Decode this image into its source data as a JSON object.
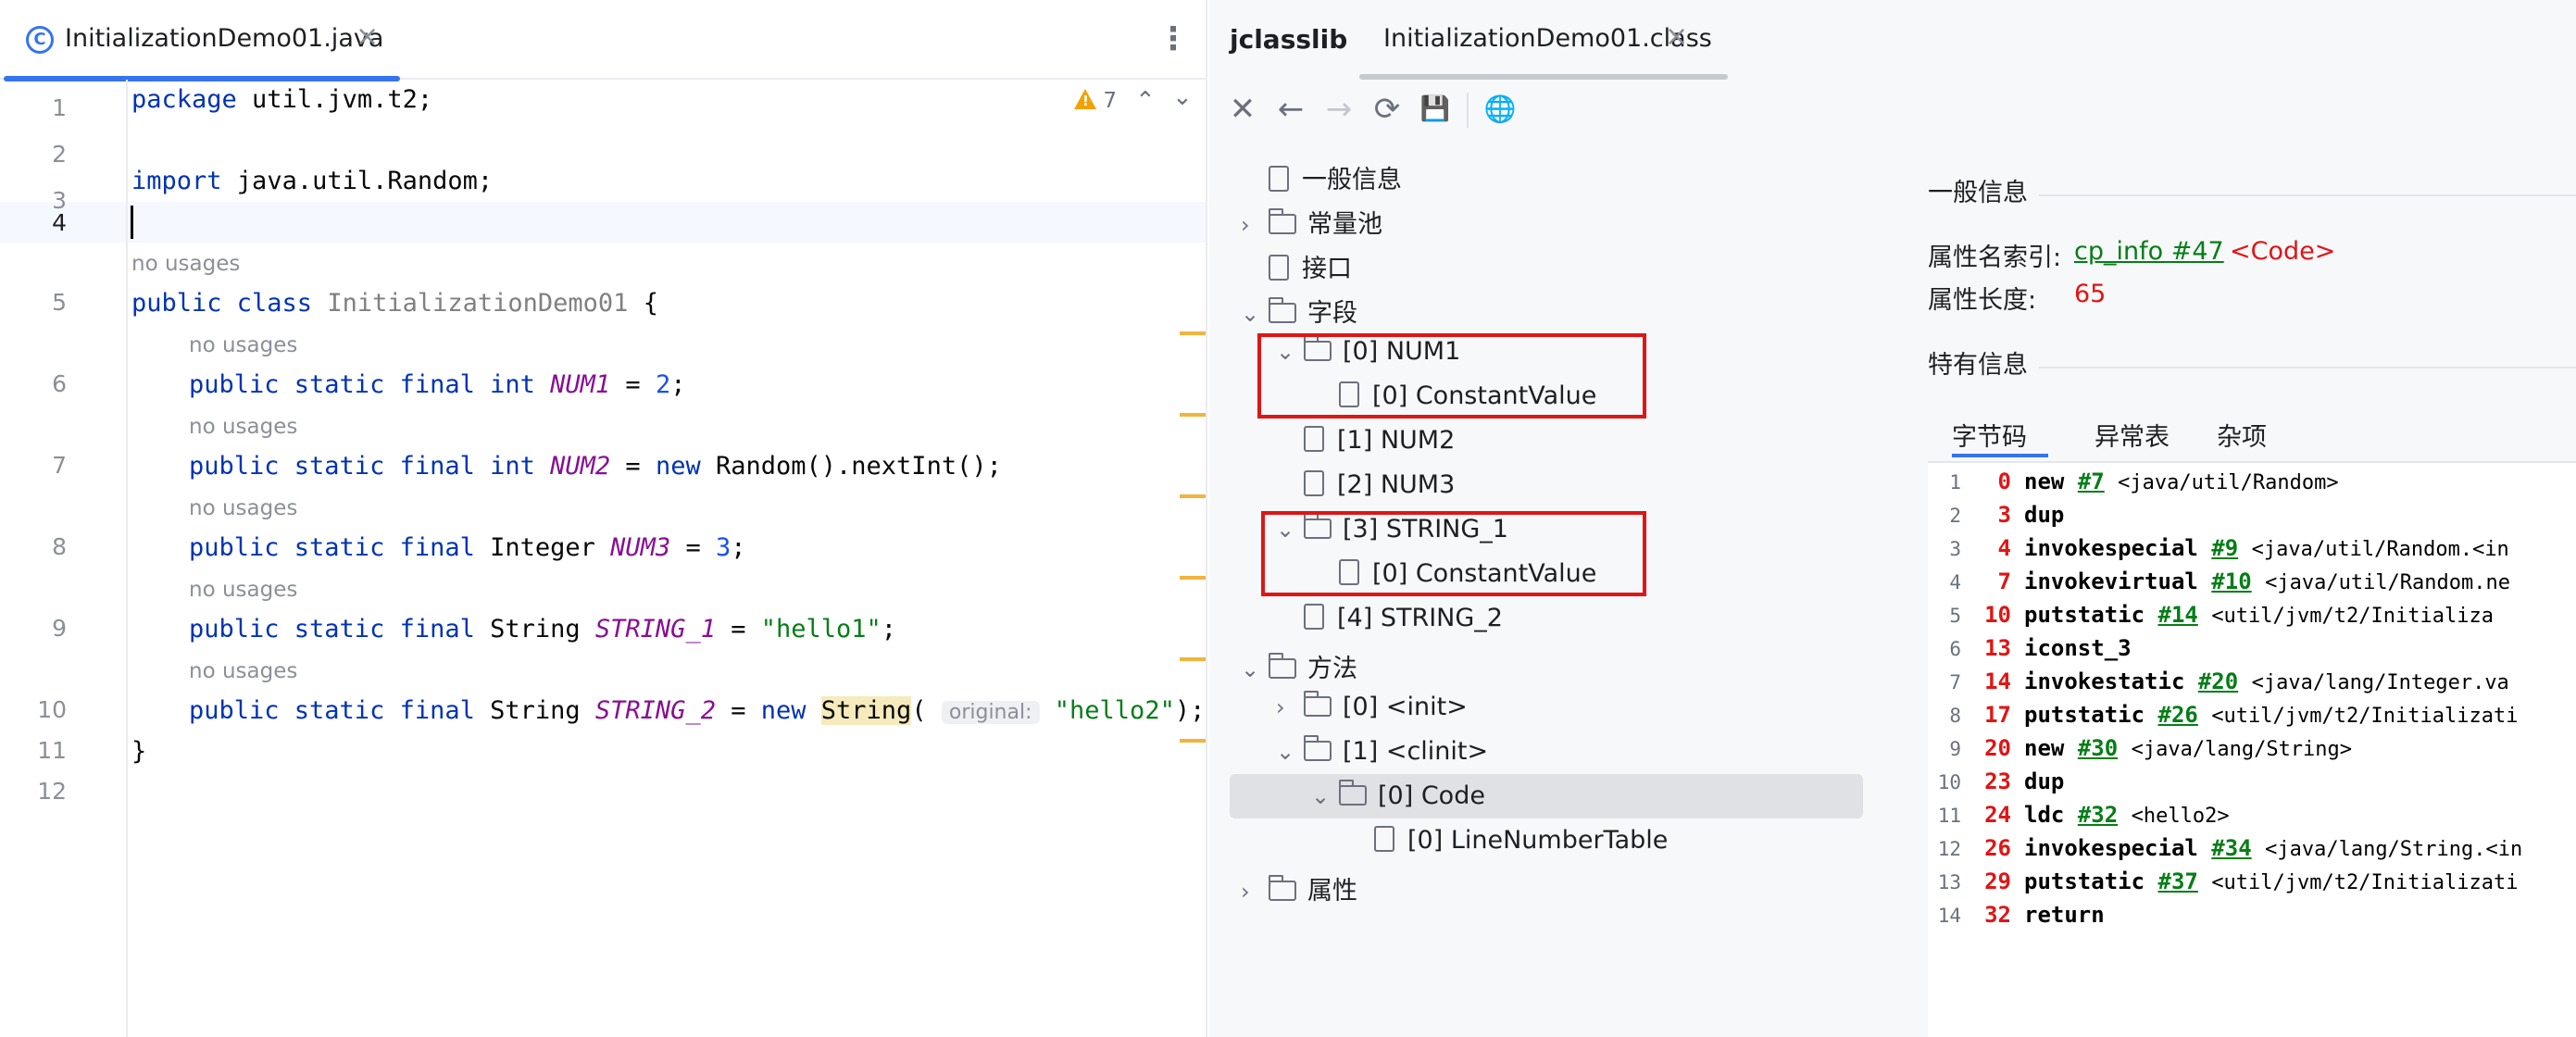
{
  "editor": {
    "tab_label": "InitializationDemo01.java",
    "tab_close": "×",
    "more": "⋮",
    "warnings": "7",
    "line_numbers": [
      "1",
      "2",
      "3",
      "4",
      "5",
      "6",
      "7",
      "8",
      "9",
      "10",
      "11",
      "12"
    ],
    "no_usages": "no usages",
    "code": {
      "l1_kw": "package",
      "l1_rest": " util.jvm.t2;",
      "l3_kw": "import",
      "l3_rest": " java.util.Random;",
      "l5_kw": "public class",
      "l5_name": " InitializationDemo01",
      "l5_rest": " {",
      "l6_kw": "public static final int",
      "l6_fld": "NUM1",
      "l6_eq": " = ",
      "l6_num": "2",
      "l6_end": ";",
      "l7_kw": "public static final int",
      "l7_fld": "NUM2",
      "l7_eq": " = ",
      "l7_new": "new",
      "l7_rest": " Random().nextInt();",
      "l8_kw": "public static final",
      "l8_type": " Integer ",
      "l8_fld": "NUM3",
      "l8_eq": " = ",
      "l8_num": "3",
      "l8_end": ";",
      "l9_kw": "public static final",
      "l9_type": " String ",
      "l9_fld": "STRING_1",
      "l9_eq": " = ",
      "l9_str": "\"hello1\"",
      "l9_end": ";",
      "l10_kw": "public static final",
      "l10_type": " String ",
      "l10_fld": "STRING_2",
      "l10_eq": " = ",
      "l10_new": "new",
      "l10_ctor": "String",
      "l10_paren": "(",
      "l10_hint": "original:",
      "l10_str": "\"hello2\"",
      "l10_end": ");",
      "l11": "}"
    }
  },
  "jclasslib": {
    "title": "jclasslib",
    "tab_label": "InitializationDemo01.class",
    "tab_close": "×",
    "toolbar": {
      "close": "✕",
      "back": "←",
      "forward": "→",
      "refresh": "⟳",
      "save": "💾",
      "web": "🌐"
    },
    "tree": [
      {
        "label": "一般信息"
      },
      {
        "label": "常量池"
      },
      {
        "label": "接口"
      },
      {
        "label": "字段"
      },
      {
        "label": "[0] NUM1"
      },
      {
        "label": "[0] ConstantValue"
      },
      {
        "label": "[1] NUM2"
      },
      {
        "label": "[2] NUM3"
      },
      {
        "label": "[3] STRING_1"
      },
      {
        "label": "[0] ConstantValue"
      },
      {
        "label": "[4] STRING_2"
      },
      {
        "label": "方法"
      },
      {
        "label": "[0] <init>"
      },
      {
        "label": "[1] <clinit>"
      },
      {
        "label": "[0] Code"
      },
      {
        "label": "[0] LineNumberTable"
      },
      {
        "label": "属性"
      }
    ],
    "detail": {
      "general_title": "一般信息",
      "attr_name_label": "属性名索引:",
      "attr_name_link": "cp_info #47",
      "attr_name_value": "<Code>",
      "attr_len_label": "属性长度:",
      "attr_len_value": "65",
      "specific_title": "特有信息",
      "tabs": [
        "字节码",
        "异常表",
        "杂项"
      ]
    },
    "bytecode": [
      {
        "no": "1",
        "off": "0",
        "op": "new",
        "ref": "#7",
        "cm": "<java/util/Random>"
      },
      {
        "no": "2",
        "off": "3",
        "op": "dup",
        "ref": "",
        "cm": ""
      },
      {
        "no": "3",
        "off": "4",
        "op": "invokespecial",
        "ref": "#9",
        "cm": "<java/util/Random.<in"
      },
      {
        "no": "4",
        "off": "7",
        "op": "invokevirtual",
        "ref": "#10",
        "cm": "<java/util/Random.ne"
      },
      {
        "no": "5",
        "off": "10",
        "op": "putstatic",
        "ref": "#14",
        "cm": "<util/jvm/t2/Initializa"
      },
      {
        "no": "6",
        "off": "13",
        "op": "iconst_3",
        "ref": "",
        "cm": ""
      },
      {
        "no": "7",
        "off": "14",
        "op": "invokestatic",
        "ref": "#20",
        "cm": "<java/lang/Integer.va"
      },
      {
        "no": "8",
        "off": "17",
        "op": "putstatic",
        "ref": "#26",
        "cm": "<util/jvm/t2/Initializati"
      },
      {
        "no": "9",
        "off": "20",
        "op": "new",
        "ref": "#30",
        "cm": "<java/lang/String>"
      },
      {
        "no": "10",
        "off": "23",
        "op": "dup",
        "ref": "",
        "cm": ""
      },
      {
        "no": "11",
        "off": "24",
        "op": "ldc",
        "ref": "#32",
        "cm": "<hello2>"
      },
      {
        "no": "12",
        "off": "26",
        "op": "invokespecial",
        "ref": "#34",
        "cm": "<java/lang/String.<in"
      },
      {
        "no": "13",
        "off": "29",
        "op": "putstatic",
        "ref": "#37",
        "cm": "<util/jvm/t2/Initializati"
      },
      {
        "no": "14",
        "off": "32",
        "op": "return",
        "ref": "",
        "cm": ""
      }
    ],
    "colors": {
      "highlight_box": "#e01515",
      "link": "#067d17",
      "offset": "#e01515"
    }
  }
}
